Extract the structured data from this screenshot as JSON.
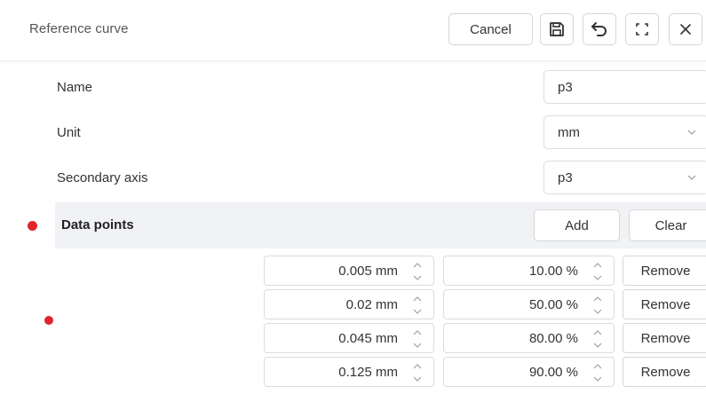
{
  "header": {
    "title": "Reference curve",
    "cancel_label": "Cancel",
    "icons": [
      "save-icon",
      "undo-icon",
      "expand-icon",
      "close-icon"
    ]
  },
  "form": {
    "name": {
      "label": "Name",
      "value": "p3"
    },
    "unit": {
      "label": "Unit",
      "value": "mm"
    },
    "secondary_axis": {
      "label": "Secondary axis",
      "value": "p3"
    }
  },
  "data_points": {
    "label": "Data points",
    "add_label": "Add",
    "clear_label": "Clear",
    "remove_label": "Remove",
    "rows": [
      {
        "x": "0.005 mm",
        "y": "10.00 %"
      },
      {
        "x": "0.02 mm",
        "y": "50.00 %"
      },
      {
        "x": "0.045 mm",
        "y": "80.00 %"
      },
      {
        "x": "0.125 mm",
        "y": "90.00 %"
      }
    ]
  },
  "colors": {
    "indicator": "#e0262b",
    "section_bg": "#f1f2f5"
  }
}
